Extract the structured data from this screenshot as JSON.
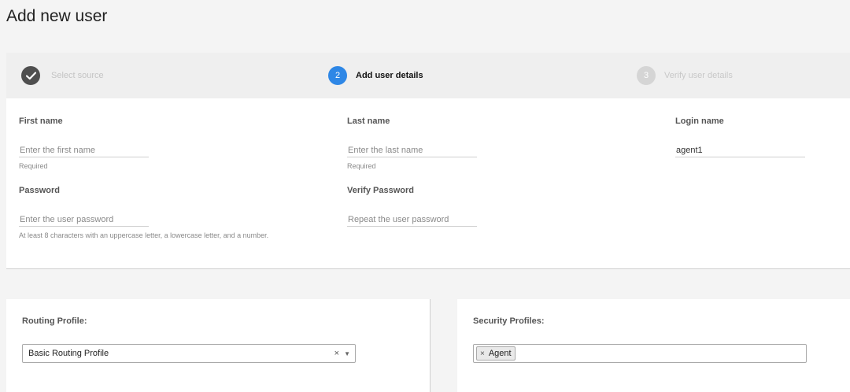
{
  "page": {
    "title": "Add new user"
  },
  "stepper": {
    "steps": [
      {
        "number": "",
        "label": "Select source",
        "state": "complete"
      },
      {
        "number": "2",
        "label": "Add user details",
        "state": "active"
      },
      {
        "number": "3",
        "label": "Verify user details",
        "state": "pending"
      }
    ]
  },
  "form": {
    "first_name": {
      "label": "First name",
      "placeholder": "Enter the first name",
      "value": "",
      "hint": "Required"
    },
    "last_name": {
      "label": "Last name",
      "placeholder": "Enter the last name",
      "value": "",
      "hint": "Required"
    },
    "login_name": {
      "label": "Login name",
      "placeholder": "",
      "value": "agent1"
    },
    "password": {
      "label": "Password",
      "placeholder": "Enter the user password",
      "value": "",
      "hint": "At least 8 characters with an uppercase letter, a lowercase letter, and a number."
    },
    "verify_password": {
      "label": "Verify Password",
      "placeholder": "Repeat the user password",
      "value": ""
    }
  },
  "routing_profile": {
    "label": "Routing Profile:",
    "selected": "Basic Routing Profile",
    "clear_icon": "×",
    "arrow_icon": "▼"
  },
  "security_profiles": {
    "label": "Security Profiles:",
    "tags": [
      {
        "label": "Agent",
        "remove_icon": "×"
      }
    ]
  },
  "icons": {
    "step_complete": "check-icon",
    "tag_remove": "close-icon",
    "select_clear": "close-icon",
    "select_arrow": "chevron-down-icon"
  },
  "colors": {
    "step_active": "#2e87e6",
    "step_complete": "#4f4f4f",
    "step_pending": "#d5d5d5"
  }
}
